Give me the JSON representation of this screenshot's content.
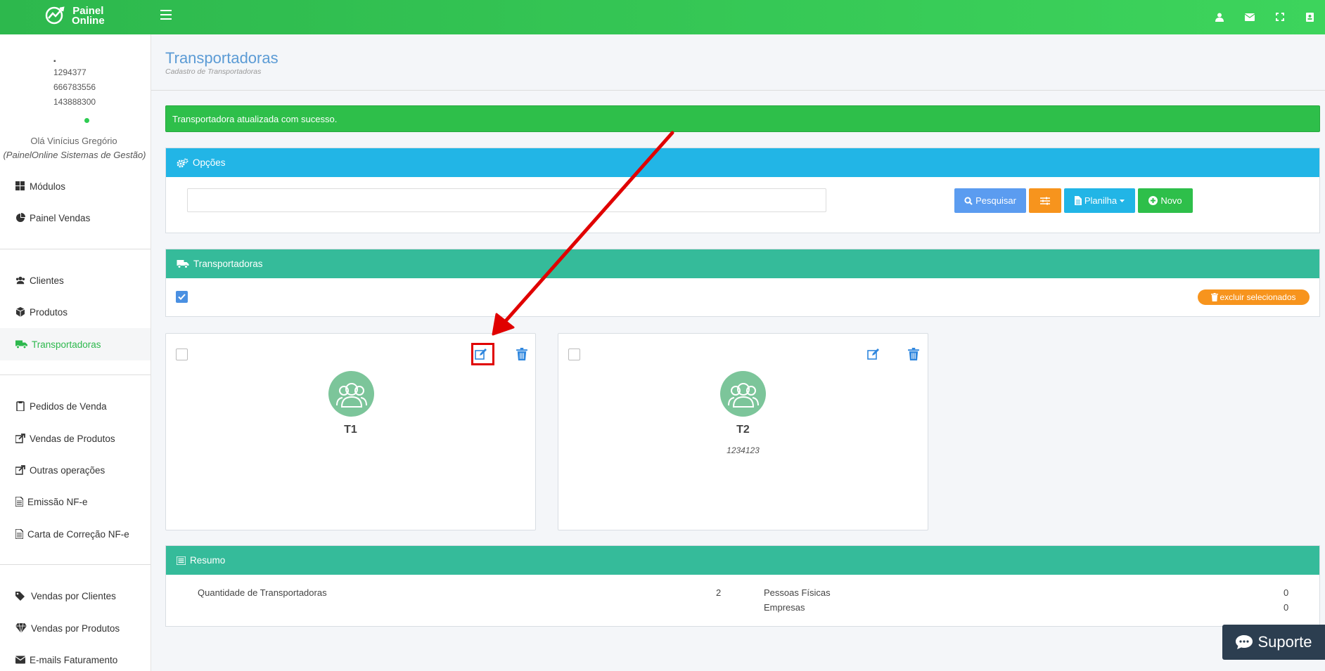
{
  "app": {
    "logo_line1": "Painel",
    "logo_line2": "Online",
    "brand_color": "#2db84d"
  },
  "topbar": {
    "icons": [
      "user-icon",
      "envelope-icon",
      "fullscreen-icon",
      "address-book-icon"
    ]
  },
  "sidebar": {
    "user_lines": [
      "1294377",
      "666783556",
      "143888300"
    ],
    "greeting": "Olá Vinícius Gregório",
    "company": "(PainelOnline Sistemas de Gestão)",
    "items": [
      {
        "label": "Módulos",
        "icon": "grid-icon"
      },
      {
        "label": "Painel Vendas",
        "icon": "pie-chart-icon"
      },
      {
        "label": "Clientes",
        "icon": "users-icon"
      },
      {
        "label": "Produtos",
        "icon": "cube-icon"
      },
      {
        "label": "Transportadoras",
        "icon": "truck-icon",
        "active": true
      },
      {
        "label": "Pedidos de Venda",
        "icon": "clipboard-icon"
      },
      {
        "label": "Vendas de Produtos",
        "icon": "share-icon"
      },
      {
        "label": "Outras operações",
        "icon": "share-icon"
      },
      {
        "label": "Emissão NF-e",
        "icon": "file-icon"
      },
      {
        "label": "Carta de Correção NF-e",
        "icon": "file-icon"
      },
      {
        "label": "Vendas por Clientes",
        "icon": "tags-icon"
      },
      {
        "label": "Vendas por Produtos",
        "icon": "diamond-icon"
      },
      {
        "label": "E-mails Faturamento",
        "icon": "envelope-icon"
      }
    ]
  },
  "page": {
    "title": "Transportadoras",
    "subtitle": "Cadastro de Transportadoras"
  },
  "alert": {
    "message": "Transportadora atualizada com sucesso."
  },
  "options_panel": {
    "title": "Opções",
    "search_value": "",
    "search_label": "Pesquisar",
    "sheet_label": "Planilha",
    "new_label": "Novo"
  },
  "list_panel": {
    "title": "Transportadoras",
    "delete_selected_label": "excluir selecionados"
  },
  "cards": [
    {
      "name": "T1",
      "doc": ""
    },
    {
      "name": "T2",
      "doc": "1234123"
    }
  ],
  "summary": {
    "title": "Resumo",
    "qty_label": "Quantidade de Transportadoras",
    "qty_value": "2",
    "pf_label": "Pessoas Físicas",
    "pf_value": "0",
    "pj_label": "Empresas",
    "pj_value": "0"
  },
  "support": {
    "label": "Suporte"
  }
}
